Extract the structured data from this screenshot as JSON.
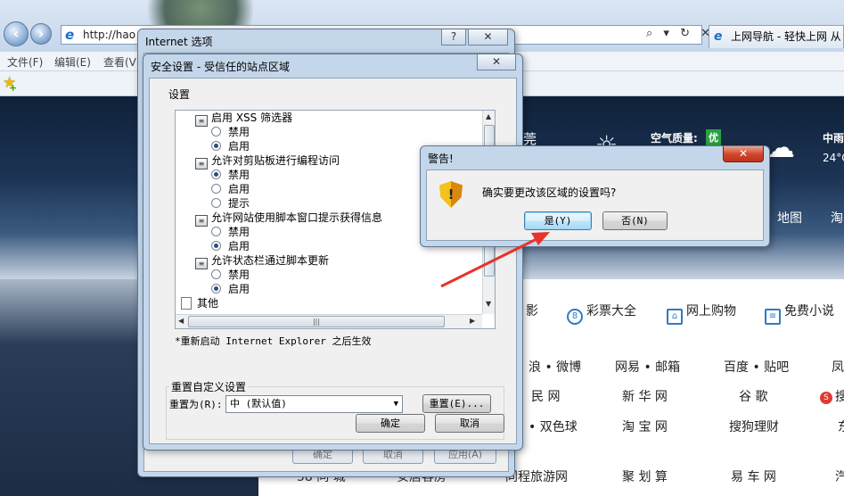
{
  "browser": {
    "address": "http://hao",
    "address_tools": "⌕ ▾ ↻ ✕",
    "tab_title": "上网导航 - 轻快上网 从",
    "menu": [
      "文件(F)",
      "编辑(E)",
      "查看(V"
    ]
  },
  "webpage": {
    "weather_city": "莞",
    "air_quality_label": "空气质量:",
    "air_quality_value": "优",
    "weather_right_1": "中雨",
    "weather_right_2": "24°C",
    "nav_map": "地图",
    "nav_more": "淘",
    "categories": [
      "影",
      "彩票大全",
      "网上购物",
      "免费小说"
    ],
    "links_row1": [
      "浪 • 微博",
      "网易 • 邮箱",
      "百度 • 贴吧",
      "凤"
    ],
    "links_row2": [
      "民 网",
      "新 华 网",
      "谷 歌",
      "搜"
    ],
    "links_row3": [
      "• 双色球",
      "淘 宝 网",
      "搜狗理财",
      "东"
    ],
    "links_row4": [
      "58 同 城",
      "安居客房",
      "同程旅游网",
      "聚 划 算",
      "易 车 网",
      "汽"
    ]
  },
  "internet_options": {
    "title": "Internet 选项",
    "help_btn": "?",
    "close_btn": "✕",
    "footer_buttons": [
      "确定",
      "取消",
      "应用(A)"
    ]
  },
  "security_settings": {
    "title": "安全设置 - 受信任的站点区域",
    "close_btn": "✕",
    "settings_label": "设置",
    "items": [
      {
        "kind": "group",
        "text": "启用 XSS 筛选器"
      },
      {
        "kind": "radio",
        "text": "禁用",
        "checked": false
      },
      {
        "kind": "radio",
        "text": "启用",
        "checked": true
      },
      {
        "kind": "group",
        "text": "允许对剪贴板进行编程访问"
      },
      {
        "kind": "radio",
        "text": "禁用",
        "checked": true
      },
      {
        "kind": "radio",
        "text": "启用",
        "checked": false
      },
      {
        "kind": "radio",
        "text": "提示",
        "checked": false
      },
      {
        "kind": "group",
        "text": "允许网站使用脚本窗口提示获得信息"
      },
      {
        "kind": "radio",
        "text": "禁用",
        "checked": false
      },
      {
        "kind": "radio",
        "text": "启用",
        "checked": true
      },
      {
        "kind": "group",
        "text": "允许状态栏通过脚本更新"
      },
      {
        "kind": "radio",
        "text": "禁用",
        "checked": false
      },
      {
        "kind": "radio",
        "text": "启用",
        "checked": true
      },
      {
        "kind": "doc",
        "text": "其他"
      }
    ],
    "restart_note": "*重新启动 Internet Explorer 之后生效",
    "reset_group_label": "重置自定义设置",
    "reset_to_label": "重置为(R):",
    "reset_level": "中 (默认值)",
    "reset_button": "重置(E)...",
    "ok_button": "确定",
    "cancel_button": "取消"
  },
  "warning": {
    "title": "警告!",
    "close_btn": "✕",
    "icon": "shield-warning-icon",
    "message": "确实要更改该区域的设置吗?",
    "yes_button": "是(Y)",
    "no_button": "否(N)"
  },
  "colors": {
    "accent_arrow": "#e8322a",
    "close_red": "#c0301a"
  }
}
